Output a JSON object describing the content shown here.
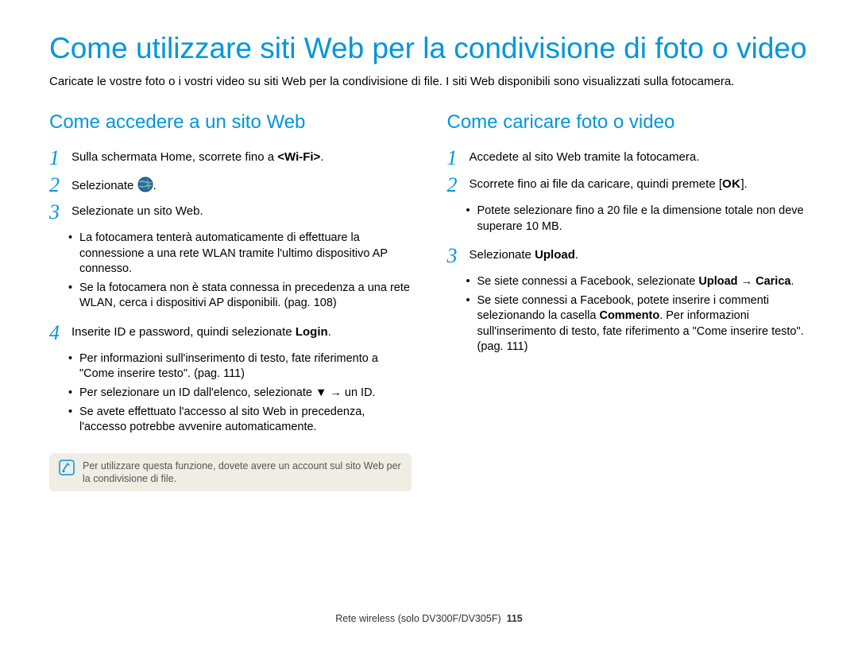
{
  "title": "Come utilizzare siti Web per la condivisione di foto o video",
  "intro": "Caricate le vostre foto o i vostri video su siti Web per la condivisione di file. I siti Web disponibili sono visualizzati sulla fotocamera.",
  "left": {
    "heading": "Come accedere a un sito Web",
    "steps": {
      "n1": "1",
      "s1a": "Sulla schermata Home, scorrete fino a ",
      "s1b": "<Wi-Fi>",
      "s1c": ".",
      "n2": "2",
      "s2a": "Selezionate ",
      "s2c": ".",
      "n3": "3",
      "s3": "Selezionate un sito Web.",
      "s3b1": "La fotocamera tenterà automaticamente di effettuare la connessione a una rete WLAN tramite l'ultimo dispositivo AP connesso.",
      "s3b2": "Se la fotocamera non è stata connessa in precedenza a una rete WLAN, cerca i dispositivi AP disponibili. (pag. 108)",
      "n4": "4",
      "s4a": "Inserite ID e password, quindi selezionate ",
      "s4b": "Login",
      "s4c": ".",
      "s4b1": "Per informazioni sull'inserimento di testo, fate riferimento a \"Come inserire testo\". (pag. 111)",
      "s4b2a": "Per selezionare un ID dall'elenco, selezionate ",
      "s4b2b": " → un ID.",
      "s4b3": "Se avete effettuato l'accesso al sito Web in precedenza, l'accesso potrebbe avvenire automaticamente."
    },
    "note": "Per utilizzare questa funzione, dovete avere un account sul sito Web per la condivisione di file."
  },
  "right": {
    "heading": "Come caricare foto o video",
    "steps": {
      "n1": "1",
      "s1": "Accedete al sito Web tramite la fotocamera.",
      "n2": "2",
      "s2a": "Scorrete fino ai file da caricare, quindi premete [",
      "s2b": "].",
      "s2b1": "Potete selezionare fino a 20 file e la dimensione totale non deve superare 10 MB.",
      "n3": "3",
      "s3a": "Selezionate ",
      "s3b": "Upload",
      "s3c": ".",
      "s3b1a": "Se siete connessi a Facebook, selezionate ",
      "s3b1b": "Upload",
      "s3b1c": " → ",
      "s3b1d": "Carica",
      "s3b1e": ".",
      "s3b2a": "Se siete connessi a Facebook, potete inserire i commenti selezionando la casella ",
      "s3b2b": "Commento",
      "s3b2c": ". Per informazioni sull'inserimento di testo, fate riferimento a \"Come inserire testo\". (pag. 111)"
    }
  },
  "footer": {
    "text": "Rete wireless (solo DV300F/DV305F)",
    "page": "115"
  },
  "icons": {
    "ok": "OK",
    "down": "▼"
  }
}
